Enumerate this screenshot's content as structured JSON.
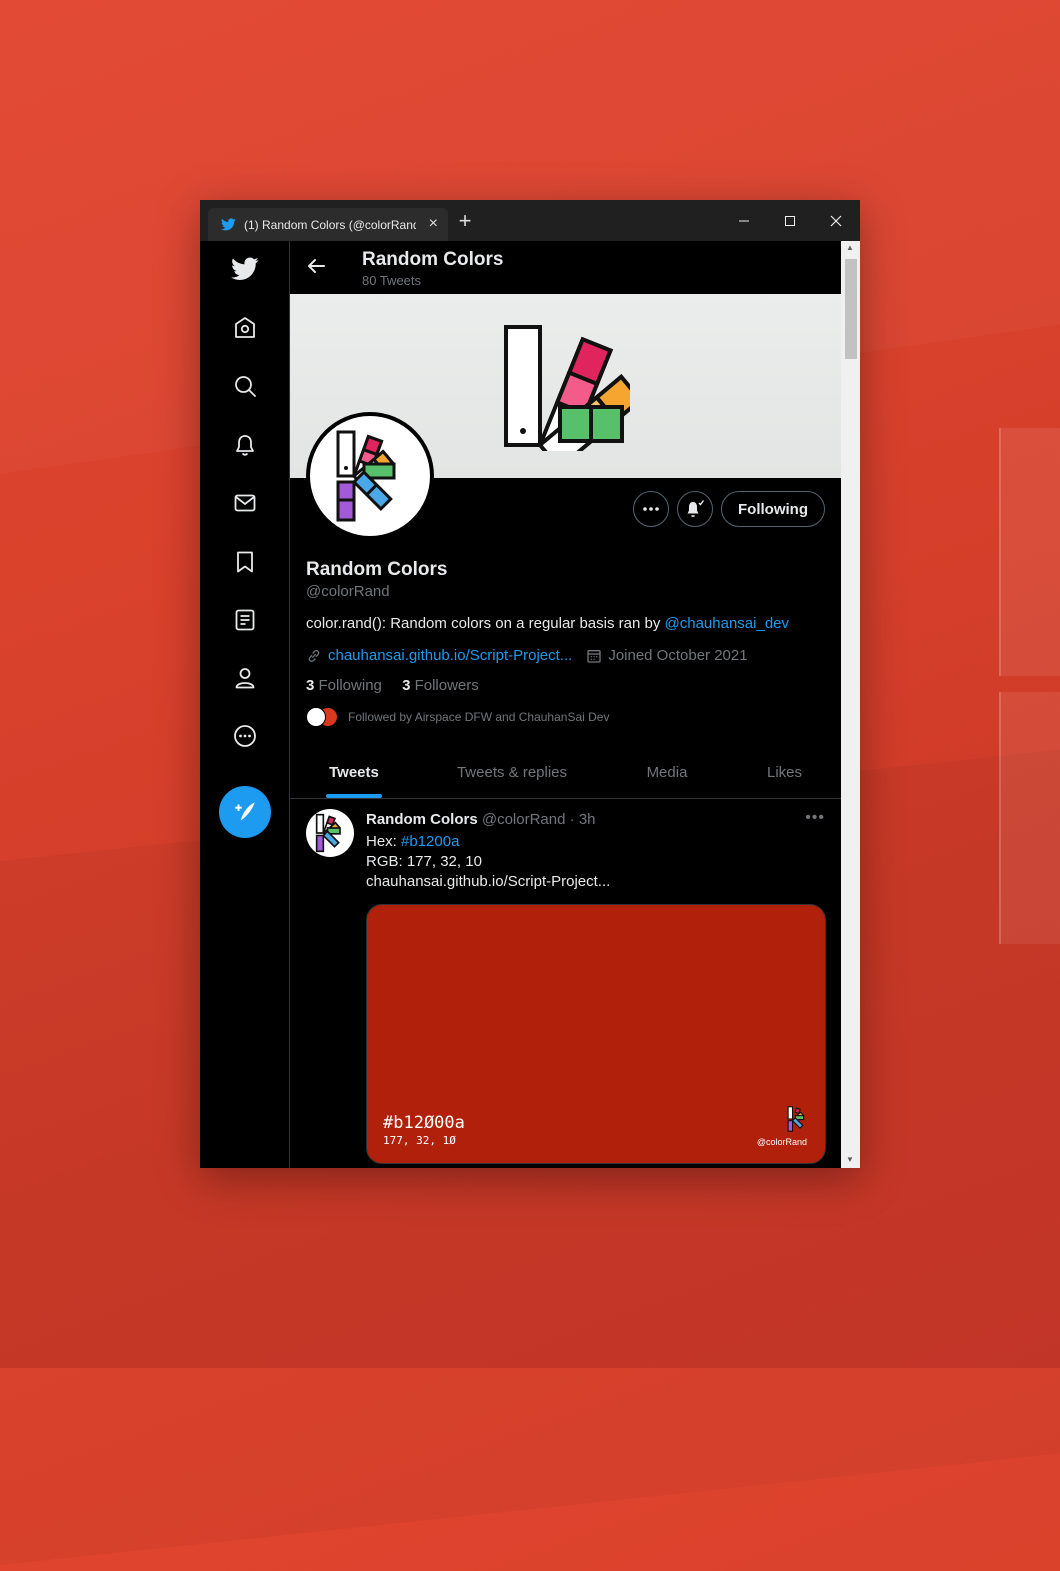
{
  "browser": {
    "tab_title": "(1) Random Colors (@colorRand",
    "tab_close": "×",
    "new_tab": "+",
    "minimize": "—",
    "maximize": "☐",
    "close": "✕"
  },
  "sidebar": {
    "items": [
      {
        "icon": "twitter-logo-icon"
      },
      {
        "icon": "home-icon"
      },
      {
        "icon": "search-icon"
      },
      {
        "icon": "notifications-bell-icon"
      },
      {
        "icon": "messages-mail-icon"
      },
      {
        "icon": "bookmark-icon"
      },
      {
        "icon": "lists-icon"
      },
      {
        "icon": "profile-person-icon"
      },
      {
        "icon": "more-circle-icon"
      }
    ],
    "compose_icon": "compose-tweet-icon"
  },
  "header": {
    "title": "Random Colors",
    "subtitle": "80 Tweets"
  },
  "profile": {
    "name": "Random Colors",
    "handle": "@colorRand",
    "bio_text": "color.rand(): Random colors on a regular basis ran by ",
    "bio_mention": "@chauhansai_dev",
    "website": "chauhansai.github.io/Script-Project...",
    "joined": "Joined October 2021",
    "following_count": "3",
    "following_label": "Following",
    "followers_count": "3",
    "followers_label": "Followers",
    "followed_by": "Followed by Airspace DFW and ChauhanSai Dev",
    "following_button": "Following"
  },
  "tabs": [
    {
      "label": "Tweets",
      "active": true
    },
    {
      "label": "Tweets & replies",
      "active": false
    },
    {
      "label": "Media",
      "active": false
    },
    {
      "label": "Likes",
      "active": false
    }
  ],
  "tweet": {
    "name": "Random Colors",
    "handle": "@colorRand",
    "sep": "·",
    "time": "3h",
    "hex_label": "Hex: ",
    "hex_value": "#b1200a",
    "rgb_line": "RGB: 177, 32, 10",
    "link": "chauhansai.github.io/Script-Project...",
    "more": "•••",
    "card": {
      "color": "#b1200a",
      "hex": "#b12Ø00a",
      "rgb": "177, 32, 1Ø",
      "handle": "@colorRand"
    }
  },
  "colors": {
    "accent": "#1d9bf0",
    "background": "#000000",
    "desktop": "#d8412c"
  }
}
